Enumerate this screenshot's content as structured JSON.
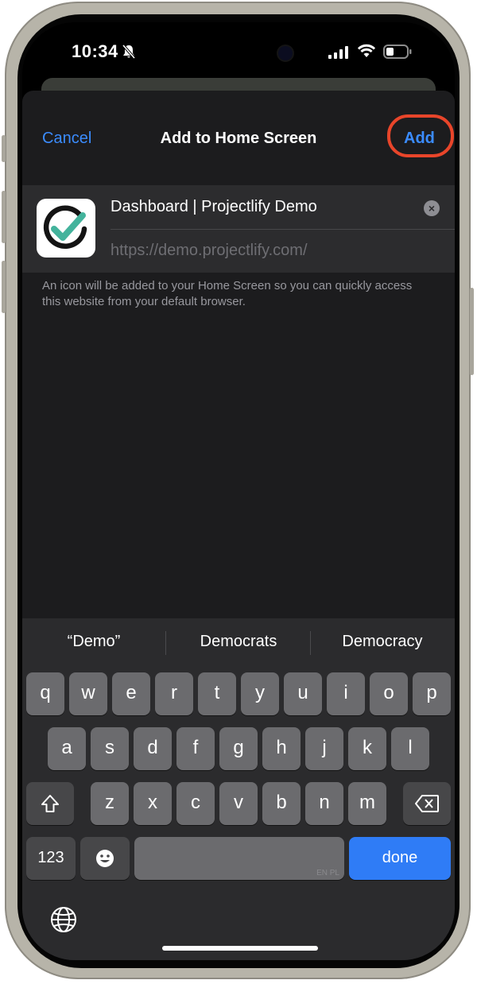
{
  "status_bar": {
    "time": "10:34"
  },
  "navbar": {
    "cancel": "Cancel",
    "title": "Add to Home Screen",
    "add": "Add"
  },
  "entry": {
    "name": "Dashboard | Projectlify Demo",
    "url": "https://demo.projectlify.com/"
  },
  "caption": "An icon will be added to your Home Screen so you can quickly access this website from your default browser.",
  "keyboard": {
    "suggestions": [
      "“Demo”",
      "Democrats",
      "Democracy"
    ],
    "row1": [
      "q",
      "w",
      "e",
      "r",
      "t",
      "y",
      "u",
      "i",
      "o",
      "p"
    ],
    "row2": [
      "a",
      "s",
      "d",
      "f",
      "g",
      "h",
      "j",
      "k",
      "l"
    ],
    "row3": [
      "z",
      "x",
      "c",
      "v",
      "b",
      "n",
      "m"
    ],
    "numbers_key": "123",
    "space_languages": "EN PL",
    "done": "done"
  },
  "colors": {
    "accent": "#3b8cff",
    "highlight": "#e8452a",
    "sheet": "#1c1c1e",
    "done_key": "#2f7cf6"
  }
}
